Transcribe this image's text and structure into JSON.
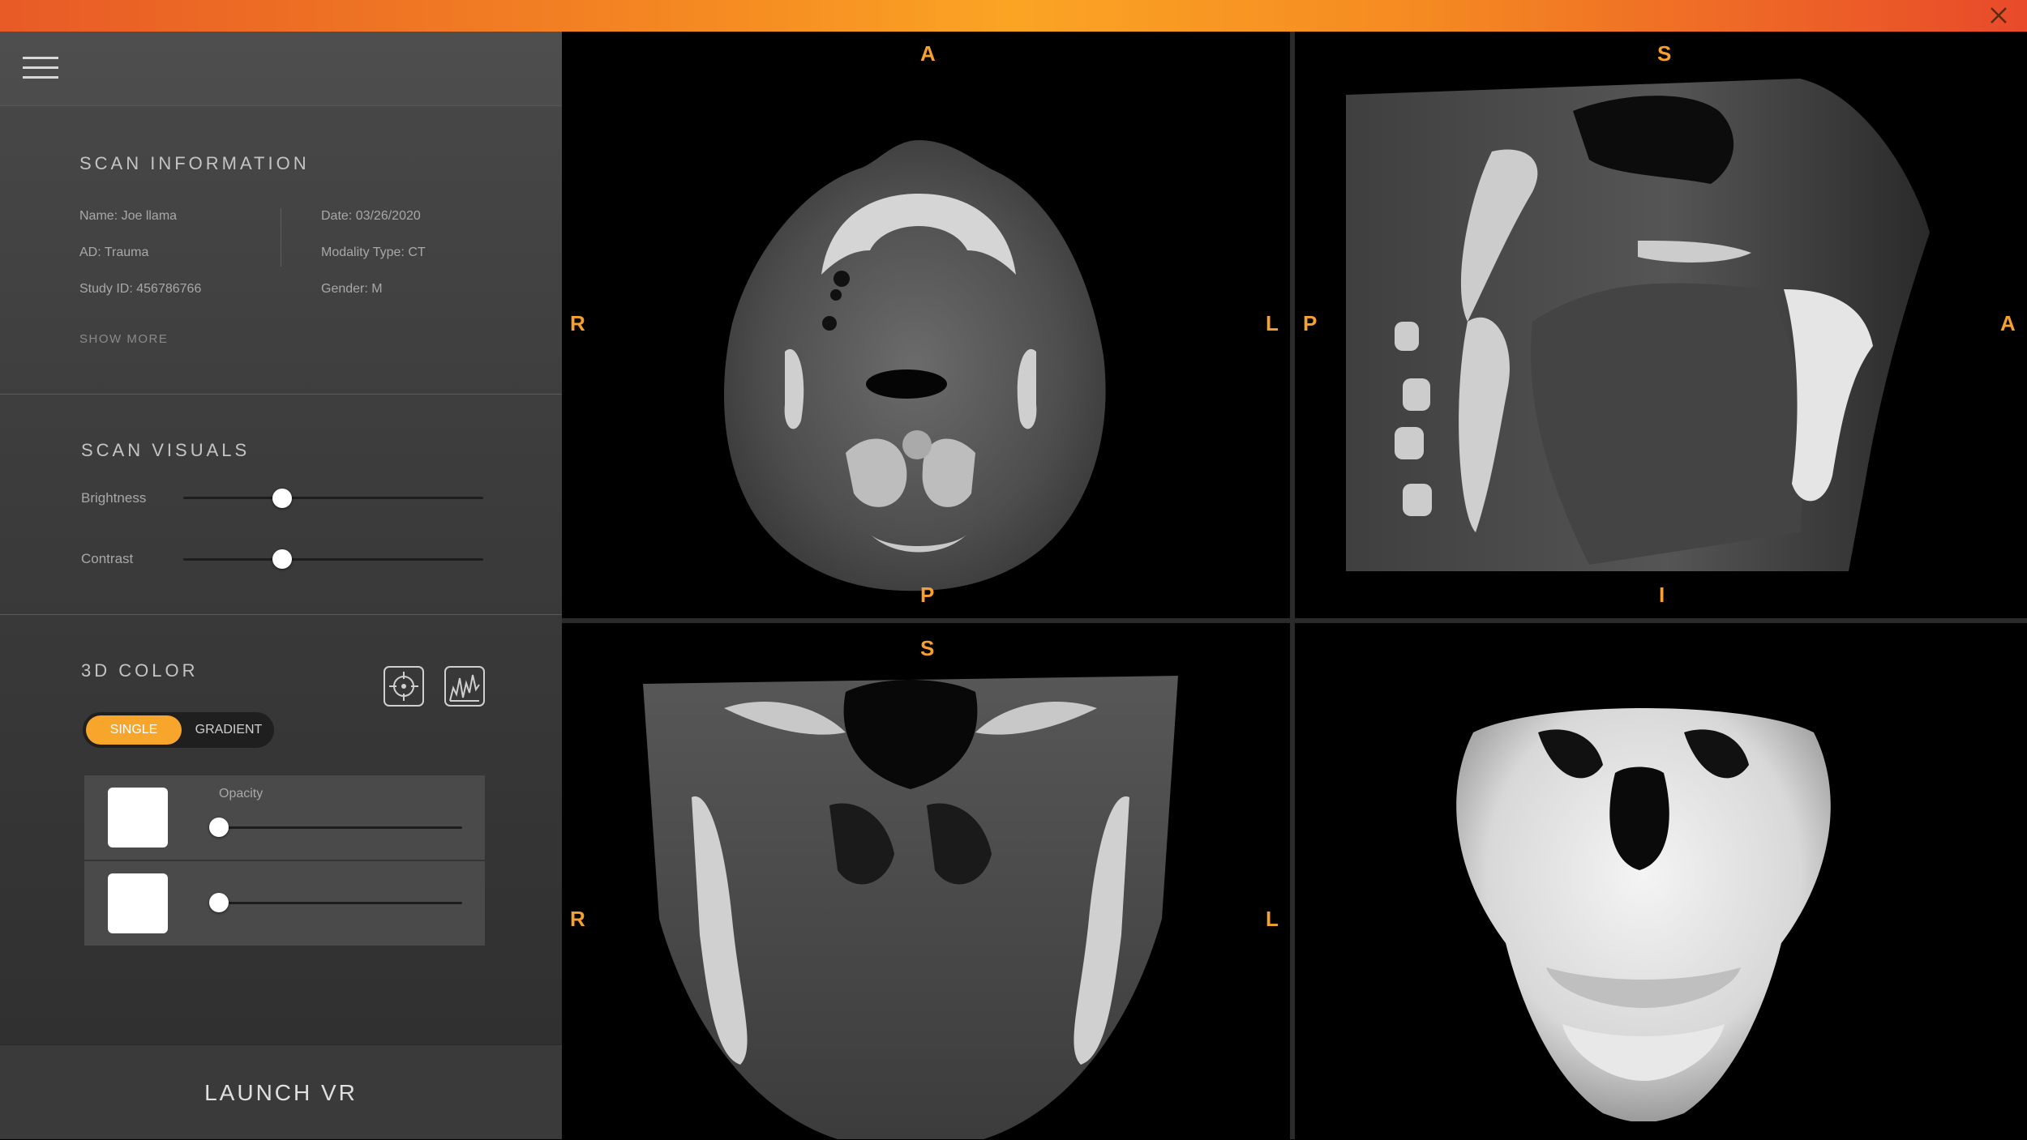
{
  "scan_information": {
    "title": "SCAN INFORMATION",
    "name": "Name: Joe llama",
    "ad": "AD: Trauma",
    "study_id": "Study ID: 456786766",
    "date": "Date: 03/26/2020",
    "modality": "Modality Type: CT",
    "gender": "Gender: M",
    "show_more": "SHOW MORE"
  },
  "scan_visuals": {
    "title": "SCAN VISUALS",
    "brightness_label": "Brightness",
    "brightness_value": 0.33,
    "contrast_label": "Contrast",
    "contrast_value": 0.33
  },
  "color_3d": {
    "title": "3D COLOR",
    "toggle_single": "SINGLE",
    "toggle_gradient": "GRADIENT",
    "selected_mode": "SINGLE",
    "opacity_label": "Opacity",
    "row1_opacity": 0.0,
    "row2_opacity": 0.0,
    "swatch_color": "#ffffff"
  },
  "launch_vr_label": "LAUNCH VR",
  "viewports": {
    "axial": {
      "top": "A",
      "bottom": "P",
      "left": "R",
      "right": "L"
    },
    "sagittal": {
      "top": "S",
      "bottom": "I",
      "left": "P",
      "right": "A"
    },
    "coronal": {
      "top": "S",
      "left": "R",
      "right": "L"
    }
  },
  "colors": {
    "accent": "#f8a52c",
    "orientation_label": "#f5a030",
    "header_gradient_left": "#e85a26",
    "header_gradient_right": "#e84a2a"
  },
  "icons": {
    "layout_grid": "grid-2x2-icon",
    "layout_single": "layout-single-icon",
    "target": "crosshair-target-icon",
    "histogram": "histogram-icon",
    "menu": "hamburger-menu-icon",
    "close": "close-icon"
  }
}
